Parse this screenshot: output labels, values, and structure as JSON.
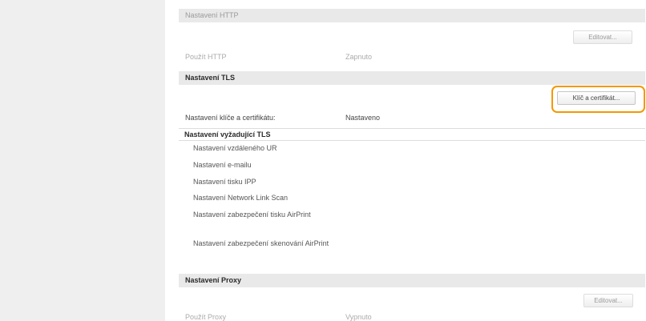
{
  "http_section": {
    "title": "Nastavení HTTP",
    "edit_label": "Editovat...",
    "use_label": "Použít HTTP",
    "use_value": "Zapnuto"
  },
  "tls_section": {
    "title": "Nastavení TLS",
    "key_cert_button": "Klíč a certifikát...",
    "key_cert_label": "Nastavení klíče a certifikátu:",
    "key_cert_value": "Nastaveno",
    "requiring_title": "Nastavení vyžadující TLS",
    "requiring_items": [
      "Nastavení vzdáleného UR",
      "Nastavení e-mailu",
      "Nastavení tisku IPP",
      "Nastavení Network Link Scan",
      "Nastavení zabezpečení tisku AirPrint",
      "Nastavení zabezpečení skenování AirPrint"
    ]
  },
  "proxy_section": {
    "title": "Nastavení Proxy",
    "edit_label": "Editovat...",
    "use_label": "Použít Proxy",
    "use_value": "Vypnuto"
  },
  "colors": {
    "highlight": "#f39800",
    "header_bg": "#e9e9e9",
    "sidebar_bg": "#efefef"
  }
}
